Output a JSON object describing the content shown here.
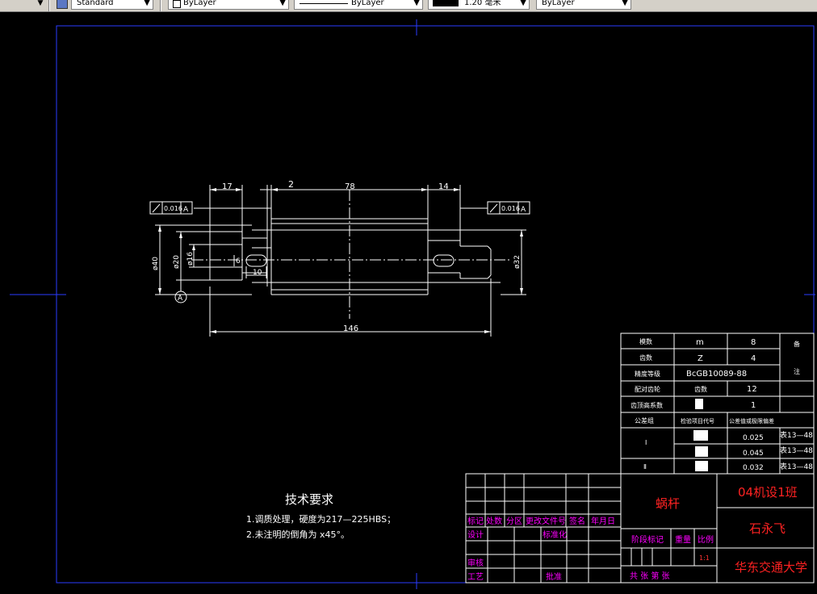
{
  "toolbar": {
    "style": "Standard",
    "layer": "ByLayer",
    "linetype": "ByLayer",
    "lineweight": "1.20 毫米",
    "plotstyle": "ByLayer"
  },
  "drawing": {
    "dims": {
      "d17": "17",
      "d2": "2",
      "d78": "78",
      "d14": "14",
      "d146": "146",
      "d10": "10",
      "dia40": "ø40",
      "dia20": "ø20",
      "dia16": "ø16",
      "dia32": "ø32",
      "d6": "6"
    },
    "tol_left": "0.016",
    "tol_right": "0.016",
    "datum": "A"
  },
  "params": {
    "r1_label": "模数",
    "r1_sym": "m",
    "r1_val": "8",
    "r2_label": "齿数",
    "r2_sym": "Z",
    "r2_val": "4",
    "r3_label": "精度等级",
    "r3_val": "BcGB10089-88",
    "r4_label": "配对齿轮",
    "r4_sym": "齿数",
    "r4_val": "12",
    "r5_label": "齿顶高系数",
    "r5_val": "1",
    "r6_label": "公差组",
    "r6_sym": "检验项目代号",
    "r6_val": "公差值或极限偏差",
    "g1": "Ⅰ",
    "g2": "Ⅱ",
    "tol1": "0.025",
    "tol2": "0.045",
    "tol3": "0.032",
    "std1": "表13—48",
    "std2": "表13—48",
    "std3": "表13—48",
    "side1": "备",
    "side2": "注"
  },
  "title_block": {
    "part_name": "蜗杆",
    "class": "04机设1班",
    "designer": "石永飞",
    "school": "华东交通大学",
    "h_mark": "标记",
    "h_qty": "处数",
    "h_zone": "分区",
    "h_doc": "更改文件号",
    "h_sign": "签名",
    "h_date": "年月日",
    "r_design": "设计",
    "r_std": "标准化",
    "r_review": "审核",
    "r_process": "工艺",
    "r_approve": "批准",
    "stage": "阶段标记",
    "weight": "重量",
    "scale": "比例",
    "scale_val": "1:1",
    "sheets": "共  张 第 张"
  },
  "tech": {
    "title": "技术要求",
    "line1": "1.调质处理，硬度为217—225HBS；",
    "line2": "2.未注明的倒角为 x45°。"
  }
}
